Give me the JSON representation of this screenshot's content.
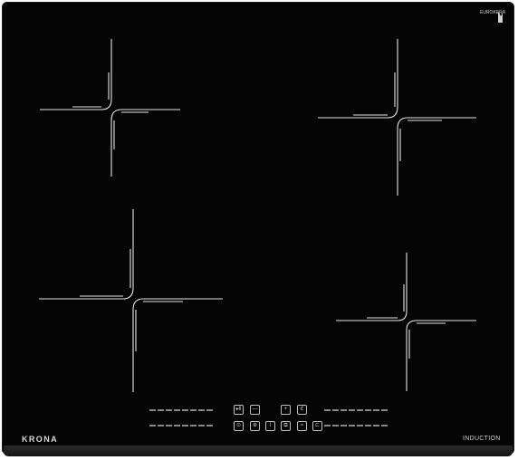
{
  "cooktop": {
    "brand": "KRONA",
    "type_label": "INDUCTION",
    "glass_brand_line1": "EUROKERA",
    "glass_brand_line2": "",
    "accent_color": "#e6e6e6",
    "glass_color": "#050505"
  },
  "zones": [
    {
      "name": "rear-left-zone"
    },
    {
      "name": "rear-right-zone"
    },
    {
      "name": "front-left-zone"
    },
    {
      "name": "front-right-zone"
    }
  ],
  "controls": {
    "top_row": [
      {
        "icon": "play-pause-icon",
        "glyph": "▸‖"
      },
      {
        "icon": "minus-icon",
        "glyph": "—"
      },
      {
        "icon": "plus-icon",
        "glyph": "+"
      },
      {
        "icon": "booster-icon",
        "glyph": "ℭ"
      }
    ],
    "bottom_row": [
      {
        "icon": "timer-icon",
        "glyph": "⊙"
      },
      {
        "icon": "lock-icon",
        "glyph": "⊕"
      },
      {
        "icon": "power-icon",
        "glyph": "ǀ"
      },
      {
        "icon": "zone-select-icon",
        "glyph": "⧉"
      },
      {
        "icon": "keep-warm-icon",
        "glyph": "≈"
      },
      {
        "icon": "pause-icon",
        "glyph": "⊏"
      }
    ]
  }
}
